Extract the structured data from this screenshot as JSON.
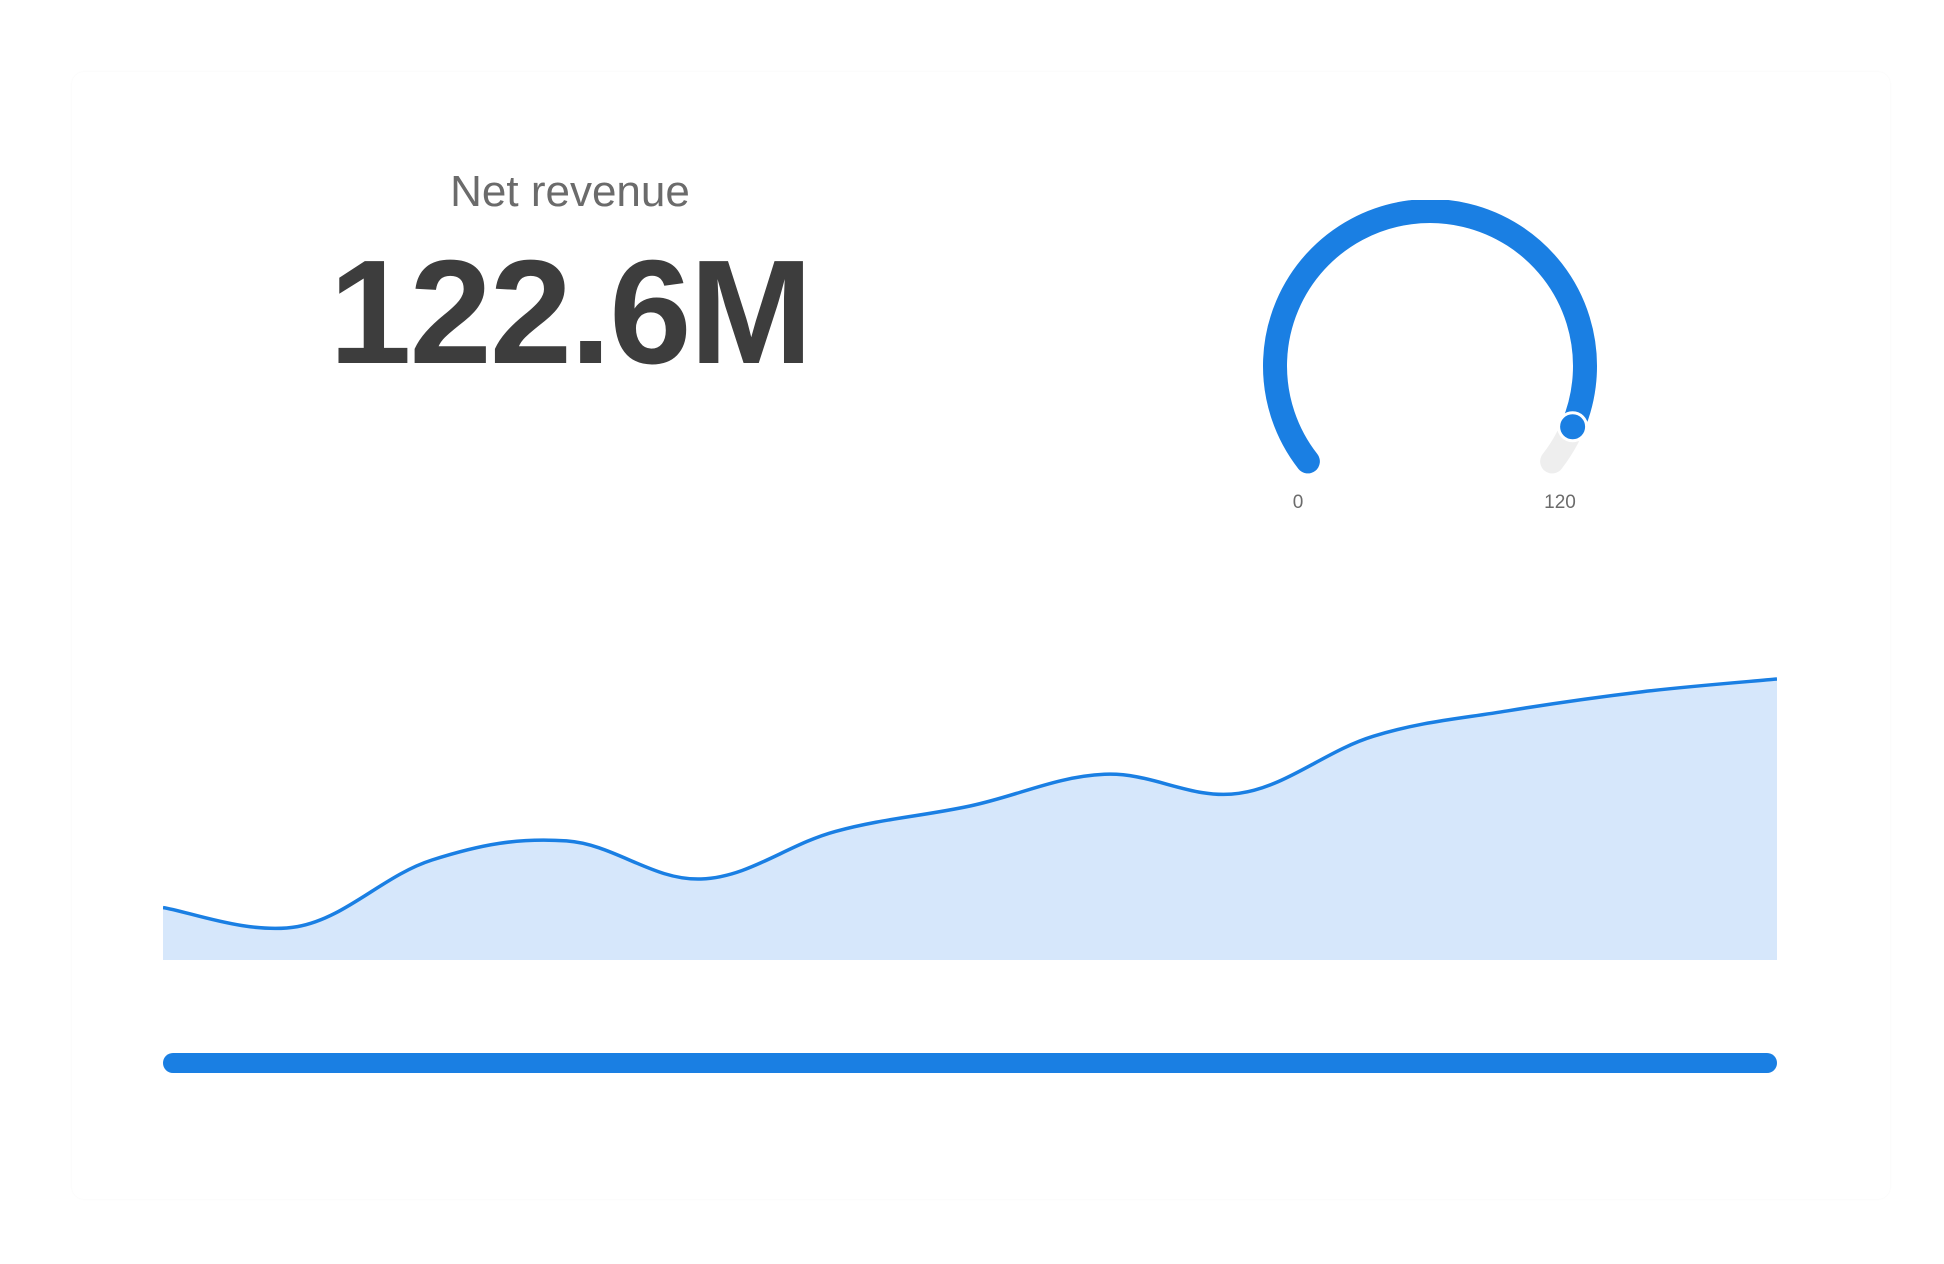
{
  "kpi": {
    "label": "Net revenue",
    "value": "122.6M"
  },
  "gauge": {
    "min_label": "0",
    "max_label": "120",
    "min": 0,
    "max": 120,
    "value": 113,
    "fill_color": "#1a7fe3",
    "track_color": "#eeeeee"
  },
  "chart_data": {
    "type": "area",
    "title": "",
    "xlabel": "",
    "ylabel": "",
    "grid": false,
    "legend": "none",
    "x": [
      0,
      1,
      2,
      3,
      4,
      5,
      6,
      7,
      8,
      9,
      10,
      11,
      12
    ],
    "values": [
      34,
      28,
      49,
      55,
      43,
      58,
      66,
      76,
      70,
      88,
      96,
      102,
      106
    ],
    "ylim": [
      20,
      112
    ],
    "line_color": "#1a7fe3",
    "fill_color": "#d6e7fb"
  },
  "progress": {
    "value": 1.0,
    "color": "#1a7fe3"
  }
}
